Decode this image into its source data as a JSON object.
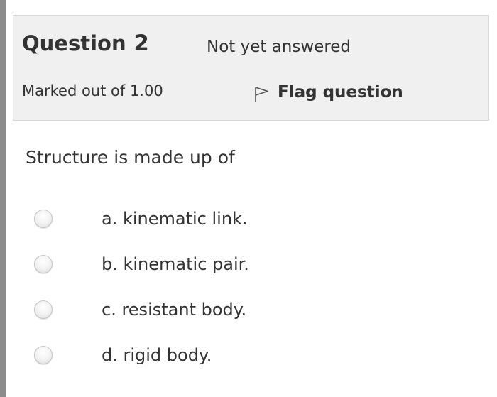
{
  "question": {
    "title_word": "Question",
    "number": "2",
    "state": "Not yet answered",
    "grade": "Marked out of 1.00",
    "flag_label": "Flag question",
    "flag_icon": "flag-outline-icon",
    "text": "Structure is made up of"
  },
  "answers": [
    {
      "label": "a. kinematic link.",
      "selected": false
    },
    {
      "label": "b. kinematic pair.",
      "selected": false
    },
    {
      "label": "c. resistant body.",
      "selected": false
    },
    {
      "label": "d. rigid body.",
      "selected": false
    }
  ]
}
